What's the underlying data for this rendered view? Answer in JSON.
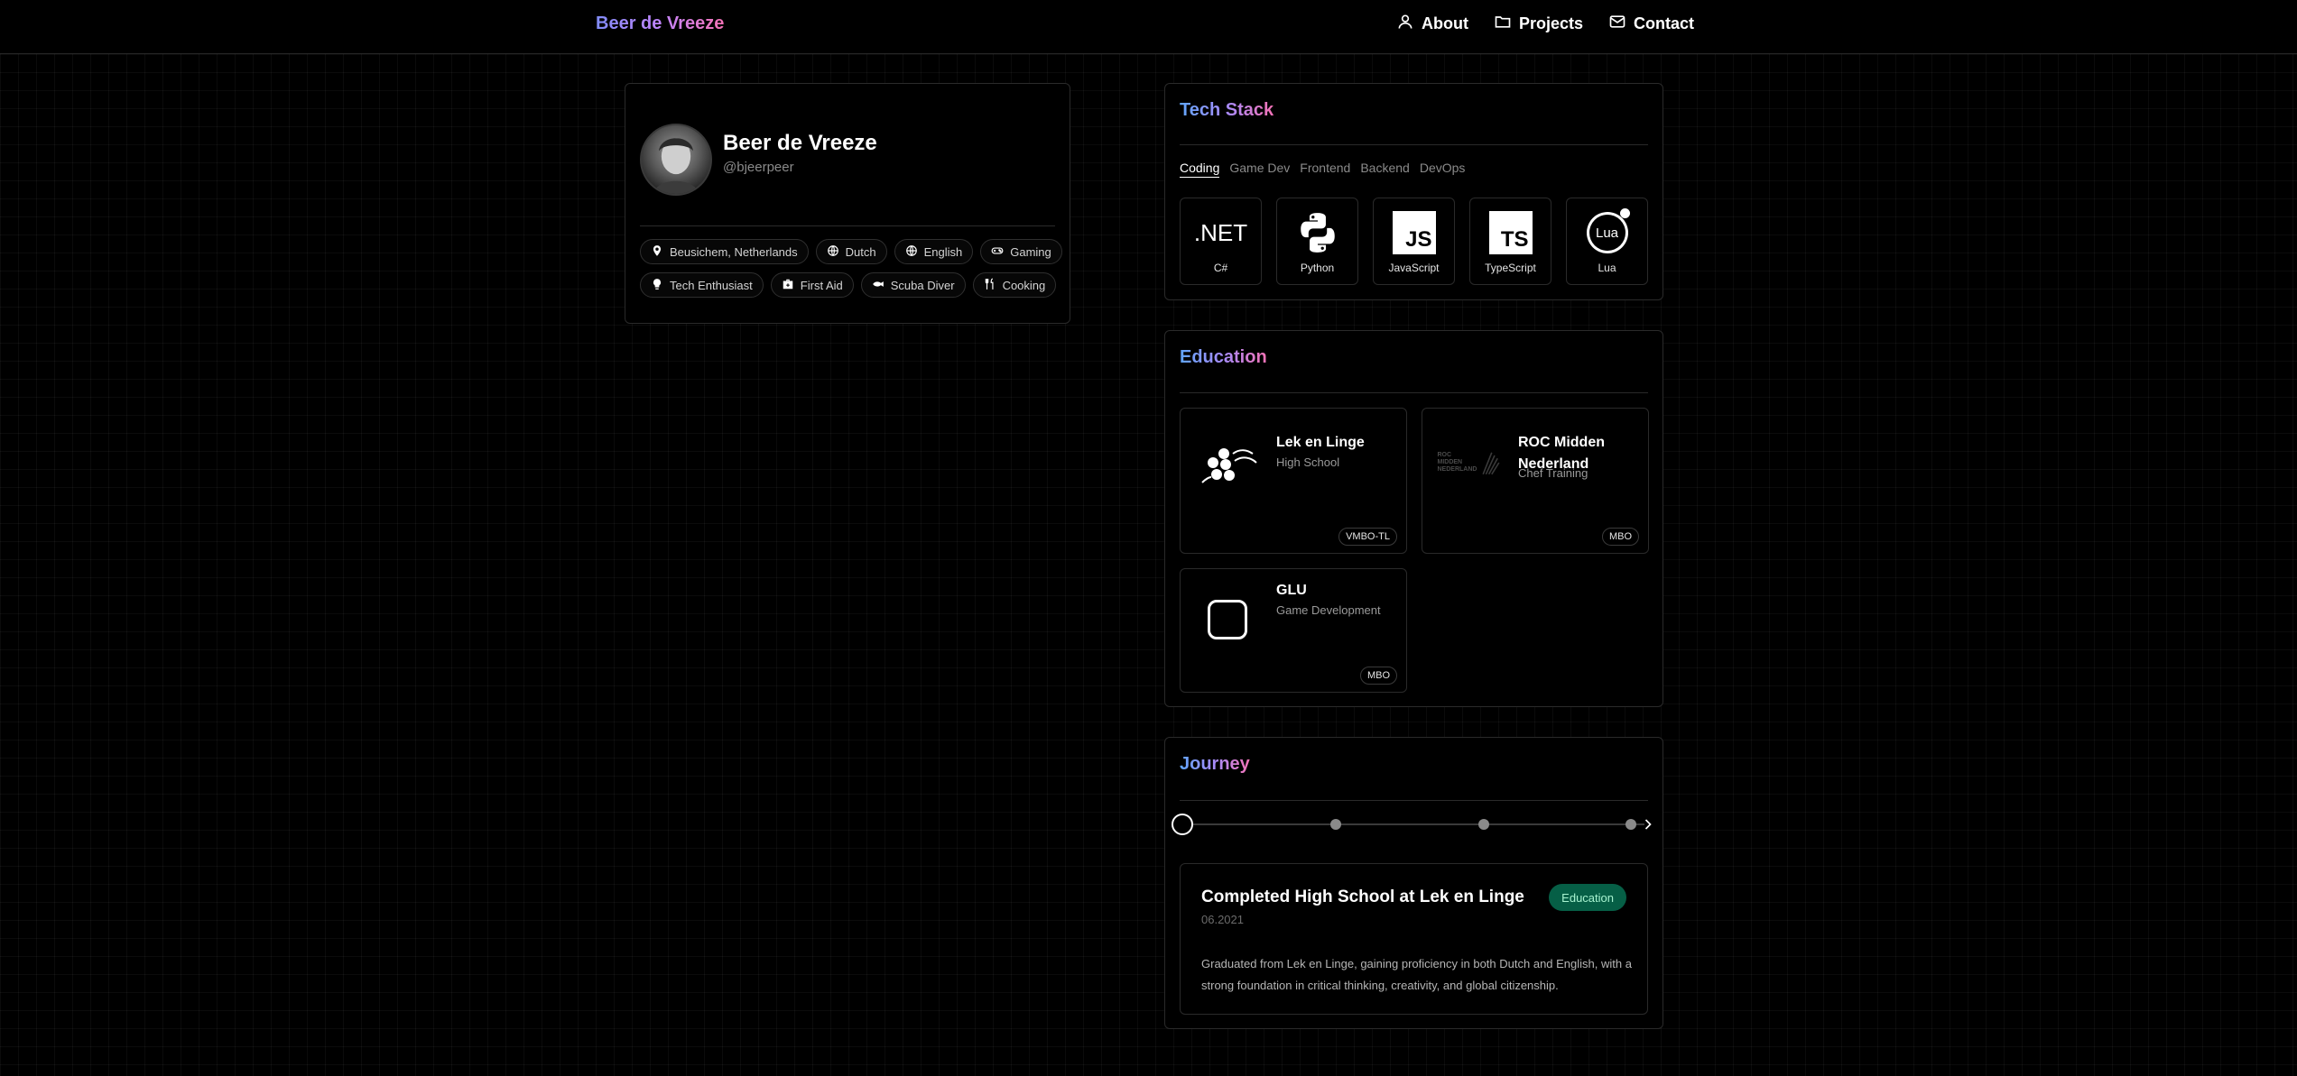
{
  "header": {
    "brand": "Beer de Vreeze",
    "nav": [
      {
        "label": "About",
        "icon": "user-icon"
      },
      {
        "label": "Projects",
        "icon": "folder-icon"
      },
      {
        "label": "Contact",
        "icon": "mail-icon"
      }
    ]
  },
  "profile": {
    "name": "Beer de Vreeze",
    "handle": "@bjeerpeer",
    "tags": [
      {
        "label": "Beusichem, Netherlands",
        "icon": "map-pin-icon"
      },
      {
        "label": "Dutch",
        "icon": "globe-icon"
      },
      {
        "label": "English",
        "icon": "globe-icon"
      },
      {
        "label": "Gaming",
        "icon": "gamepad-icon"
      },
      {
        "label": "Tech Enthusiast",
        "icon": "lightbulb-icon"
      },
      {
        "label": "First Aid",
        "icon": "first-aid-kit-icon"
      },
      {
        "label": "Scuba Diver",
        "icon": "fish-icon"
      },
      {
        "label": "Cooking",
        "icon": "utensils-icon"
      }
    ]
  },
  "tech_stack": {
    "title": "Tech Stack",
    "tabs": [
      "Coding",
      "Game Dev",
      "Frontend",
      "Backend",
      "DevOps"
    ],
    "active_tab": "Coding",
    "items": [
      {
        "label": "C#",
        "logo_text": ".NET",
        "icon": "dotnet-logo-icon"
      },
      {
        "label": "Python",
        "icon": "python-logo-icon"
      },
      {
        "label": "JavaScript",
        "logo_text": "JS",
        "icon": "javascript-logo-icon"
      },
      {
        "label": "TypeScript",
        "logo_text": "TS",
        "icon": "typescript-logo-icon"
      },
      {
        "label": "Lua",
        "logo_text": "Lua",
        "icon": "lua-logo-icon"
      }
    ]
  },
  "education": {
    "title": "Education",
    "schools": [
      {
        "name": "Lek en Linge",
        "type": "High School",
        "level": "VMBO-TL",
        "icon": "lek-en-linge-logo-icon"
      },
      {
        "name": "ROC Midden Nederland",
        "type": "Chef Training",
        "level": "MBO",
        "logo_text": "ROC MIDDEN NEDERLAND",
        "icon": "roc-midden-nederland-logo-icon"
      },
      {
        "name": "GLU",
        "type": "Game Development",
        "level": "MBO",
        "icon": "glu-logo-icon"
      }
    ]
  },
  "journey": {
    "title": "Journey",
    "event": {
      "title": "Completed High School at Lek en Linge",
      "date": "06.2021",
      "category": "Education",
      "description": "Graduated from Lek en Linge, gaining proficiency in both Dutch and English, with a strong foundation in critical thinking, creativity, and global citizenship."
    }
  },
  "colors": {
    "background": "#000000",
    "brand_gradient": [
      "#818cf8",
      "#c084fc",
      "#f472b6"
    ],
    "education_badge": "#065f46"
  }
}
